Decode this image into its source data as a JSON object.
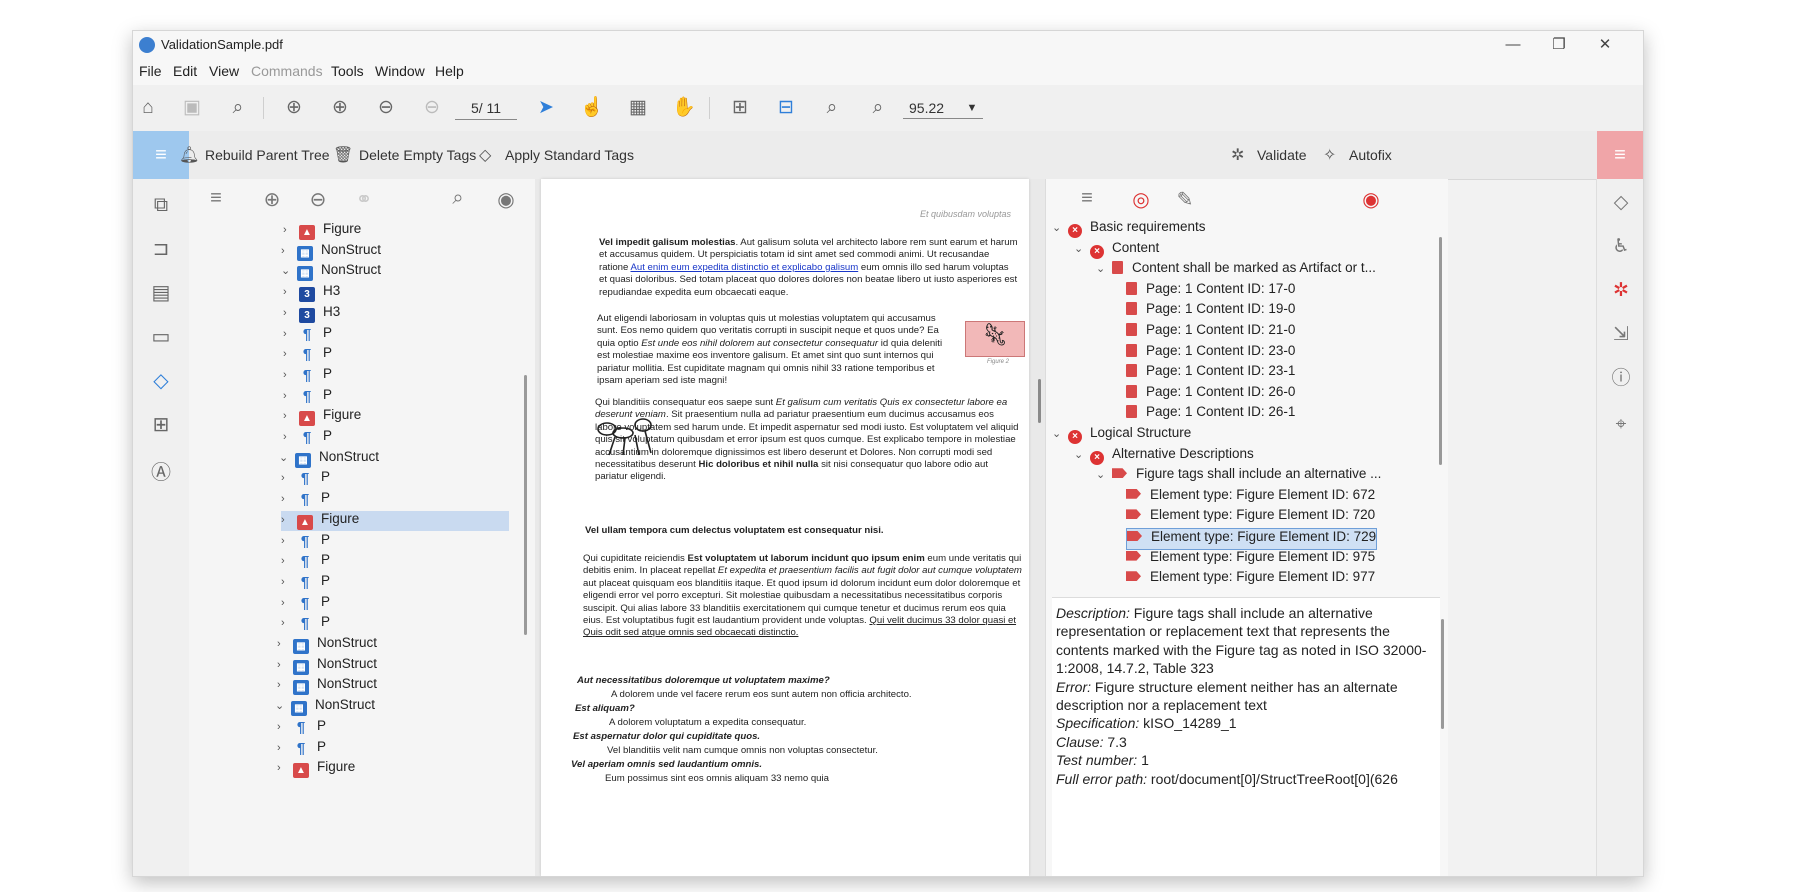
{
  "window": {
    "title": "ValidationSample.pdf"
  },
  "menu": [
    "File",
    "Edit",
    "View",
    "Commands",
    "Tools",
    "Window",
    "Help"
  ],
  "toolbar": {
    "page": "5/ 11",
    "zoom": "95.22"
  },
  "tagbar": {
    "rebuild": "Rebuild Parent Tree",
    "delete_empty": "Delete Empty Tags",
    "apply_standard": "Apply Standard Tags",
    "validate": "Validate",
    "autofix": "Autofix"
  },
  "tag_tree": [
    {
      "indent": 4,
      "chev": ">",
      "icon": "fig",
      "label": "Figure"
    },
    {
      "indent": 3,
      "chev": ">",
      "icon": "ns",
      "label": "NonStruct"
    },
    {
      "indent": 3,
      "chev": "v",
      "icon": "ns",
      "label": "NonStruct"
    },
    {
      "indent": 4,
      "chev": ">",
      "icon": "h",
      "label": "H3"
    },
    {
      "indent": 4,
      "chev": ">",
      "icon": "h",
      "label": "H3"
    },
    {
      "indent": 4,
      "chev": ">",
      "icon": "p",
      "label": "P"
    },
    {
      "indent": 4,
      "chev": ">",
      "icon": "p",
      "label": "P"
    },
    {
      "indent": 4,
      "chev": ">",
      "icon": "p",
      "label": "P"
    },
    {
      "indent": 4,
      "chev": ">",
      "icon": "p",
      "label": "P"
    },
    {
      "indent": 4,
      "chev": ">",
      "icon": "fig",
      "label": "Figure"
    },
    {
      "indent": 4,
      "chev": ">",
      "icon": "p",
      "label": "P"
    },
    {
      "indent": 2,
      "chev": "v",
      "icon": "ns",
      "label": "NonStruct"
    },
    {
      "indent": 3,
      "chev": ">",
      "icon": "p",
      "label": "P"
    },
    {
      "indent": 3,
      "chev": ">",
      "icon": "p",
      "label": "P"
    },
    {
      "indent": 3,
      "chev": ">",
      "icon": "fig",
      "label": "Figure",
      "selected": true
    },
    {
      "indent": 3,
      "chev": ">",
      "icon": "p",
      "label": "P"
    },
    {
      "indent": 3,
      "chev": ">",
      "icon": "p",
      "label": "P"
    },
    {
      "indent": 3,
      "chev": ">",
      "icon": "p",
      "label": "P"
    },
    {
      "indent": 3,
      "chev": ">",
      "icon": "p",
      "label": "P"
    },
    {
      "indent": 3,
      "chev": ">",
      "icon": "p",
      "label": "P"
    },
    {
      "indent": 1,
      "chev": ">",
      "icon": "ns",
      "label": "NonStruct"
    },
    {
      "indent": 1,
      "chev": ">",
      "icon": "ns",
      "label": "NonStruct"
    },
    {
      "indent": 1,
      "chev": ">",
      "icon": "ns",
      "label": "NonStruct"
    },
    {
      "indent": 0,
      "chev": "v",
      "icon": "ns",
      "label": "NonStruct"
    },
    {
      "indent": 1,
      "chev": ">",
      "icon": "p",
      "label": "P"
    },
    {
      "indent": 1,
      "chev": ">",
      "icon": "p",
      "label": "P"
    },
    {
      "indent": 1,
      "chev": ">",
      "icon": "fig",
      "label": "Figure"
    }
  ],
  "document": {
    "running_head": "Et quibusdam voluptas",
    "p1_bold": "Vel impedit galisum molestias",
    "p1a": ". Aut galisum soluta vel architecto labore rem sunt earum et harum et accusamus quidem. Ut perspiciatis totam id sint amet sed commodi animi. Ut recusandae ratione ",
    "p1_link": "Aut enim eum expedita distinctio et explicabo galisum",
    "p1b": " eum omnis illo sed harum voluptas et quasi doloribus. Sed totam placeat quo dolores dolores non beatae libero ut iusto asperiores est repudiandae expedita eum obcaecati eaque.",
    "p2a": "Aut eligendi laboriosam in voluptas quis ut molestias voluptatem qui accusamus sunt. Eos nemo quidem quo veritatis corrupti in suscipit neque et quos unde? Ea quia optio ",
    "p2_italic": "Est unde eos nihil dolorem aut consectetur consequatur",
    "p2b": " id quia deleniti est molestiae maxime eos inventore galisum. Et amet sint quo sunt internos qui pariatur mollitia. Est cupiditate magnam qui omnis nihil 33 ratione temporibus et ipsam aperiam sed iste magni!",
    "figure2_caption": "Figure 2",
    "p3a": "Qui blanditiis consequatur eos saepe sunt ",
    "p3_italic": "Et galisum cum veritatis Quis ex consectetur labore ea deserunt veniam",
    "p3b": ". Sit praesentium nulla ad pariatur praesentium eum ducimus accusamus eos labore voluptatem sed harum unde. Et impedit aspernatur sed modi iusto. Est voluptatem vel aliquid quis sit voluptatum quibusdam et error ipsum est quos cumque. Est explicabo tempore in molestiae accusantium in doloremque dignissimos est libero deserunt et Dolores. Non corrupti modi sed necessitatibus deserunt ",
    "p3_bold": "Hic doloribus et nihil nulla",
    "p3c": " sit nisi consequatur quo labore odio aut pariatur eligendi.",
    "heading1": "Vel ullam tempora cum delectus voluptatem est consequatur nisi.",
    "p4a": "Qui cupiditate reiciendis ",
    "p4_bold": "Est voluptatem ut laborum incidunt quo ipsum enim",
    "p4b": " eum unde veritatis qui debitis enim. In placeat repellat ",
    "p4_italic": "Et expedita et praesentium facilis aut fugit dolor aut cumque voluptatem",
    "p4c": " aut placeat quisquam eos blanditiis itaque. Et quod ipsum id dolorum incidunt eum dolor doloremque et eligendi error vel porro excepturi. Sit molestiae quibusdam a necessitatibus necessitatibus corporis suscipit. Qui alias labore 33 blanditiis exercitationem qui cumque tenetur et ducimus rerum eos quia eius. Est voluptatibus fugit est laudantium provident unde voluptas. ",
    "p4_underline": "Qui velit ducimus 33 dolor quasi et Quis odit sed atque omnis sed obcaecati distinctio.",
    "q1": "Aut necessitatibus doloremque ut voluptatem maxime?",
    "a1": "A dolorem unde vel facere rerum eos sunt autem non officia architecto.",
    "q2": "Est aliquam?",
    "a2": "A dolorem voluptatum a expedita consequatur.",
    "q3": "Est aspernatur dolor qui cupiditate quos.",
    "a3": "Vel blanditiis velit nam cumque omnis non voluptas consectetur.",
    "q4": "Vel aperiam omnis sed laudantium omnis.",
    "a4": "Eum possimus sint eos omnis aliquam 33 nemo quia"
  },
  "validation_tree": [
    {
      "indent": 0,
      "chev": "v",
      "icon": "err",
      "label": "Basic requirements"
    },
    {
      "indent": 1,
      "chev": "v",
      "icon": "err",
      "label": "Content"
    },
    {
      "indent": 2,
      "chev": "v",
      "icon": "doc",
      "label": "Content shall be marked as Artifact or t..."
    },
    {
      "indent": 3,
      "chev": "",
      "icon": "doc",
      "label": "Page: 1 Content ID: 17-0"
    },
    {
      "indent": 3,
      "chev": "",
      "icon": "doc",
      "label": "Page: 1 Content ID: 19-0"
    },
    {
      "indent": 3,
      "chev": "",
      "icon": "doc",
      "label": "Page: 1 Content ID: 21-0"
    },
    {
      "indent": 3,
      "chev": "",
      "icon": "doc",
      "label": "Page: 1 Content ID: 23-0"
    },
    {
      "indent": 3,
      "chev": "",
      "icon": "doc",
      "label": "Page: 1 Content ID: 23-1"
    },
    {
      "indent": 3,
      "chev": "",
      "icon": "doc",
      "label": "Page: 1 Content ID: 26-0"
    },
    {
      "indent": 3,
      "chev": "",
      "icon": "doc",
      "label": "Page: 1 Content ID: 26-1"
    },
    {
      "indent": 0,
      "chev": "v",
      "icon": "err",
      "label": "Logical Structure"
    },
    {
      "indent": 1,
      "chev": "v",
      "icon": "err",
      "label": "Alternative Descriptions"
    },
    {
      "indent": 2,
      "chev": "v",
      "icon": "tag",
      "label": "Figure tags shall include an alternative ..."
    },
    {
      "indent": 3,
      "chev": "",
      "icon": "tag",
      "label": "Element type: Figure Element ID:  672"
    },
    {
      "indent": 3,
      "chev": "",
      "icon": "tag",
      "label": "Element type: Figure Element ID:  720"
    },
    {
      "indent": 3,
      "chev": "",
      "icon": "tag",
      "label": "Element type: Figure Element ID:  729",
      "selected": true
    },
    {
      "indent": 3,
      "chev": "",
      "icon": "tag",
      "label": "Element type: Figure Element ID:  975"
    },
    {
      "indent": 3,
      "chev": "",
      "icon": "tag",
      "label": "Element type: Figure Element ID:  977"
    }
  ],
  "details": {
    "description_label": "Description:",
    "description": " Figure tags shall include an alternative representation or replacement text that represents the contents marked with the Figure tag as noted in ISO 32000-1:2008, 14.7.2, Table 323",
    "error_label": "Error:",
    "error": " Figure structure element neither has an alternate description nor a replacement text",
    "spec_label": "Specification:",
    "spec": " kISO_14289_1",
    "clause_label": "Clause:",
    "clause": " 7.3",
    "test_label": "Test number:",
    "test": " 1",
    "path_label": "Full error path:",
    "path": " root/document[0]/StructTreeRoot[0](626"
  }
}
